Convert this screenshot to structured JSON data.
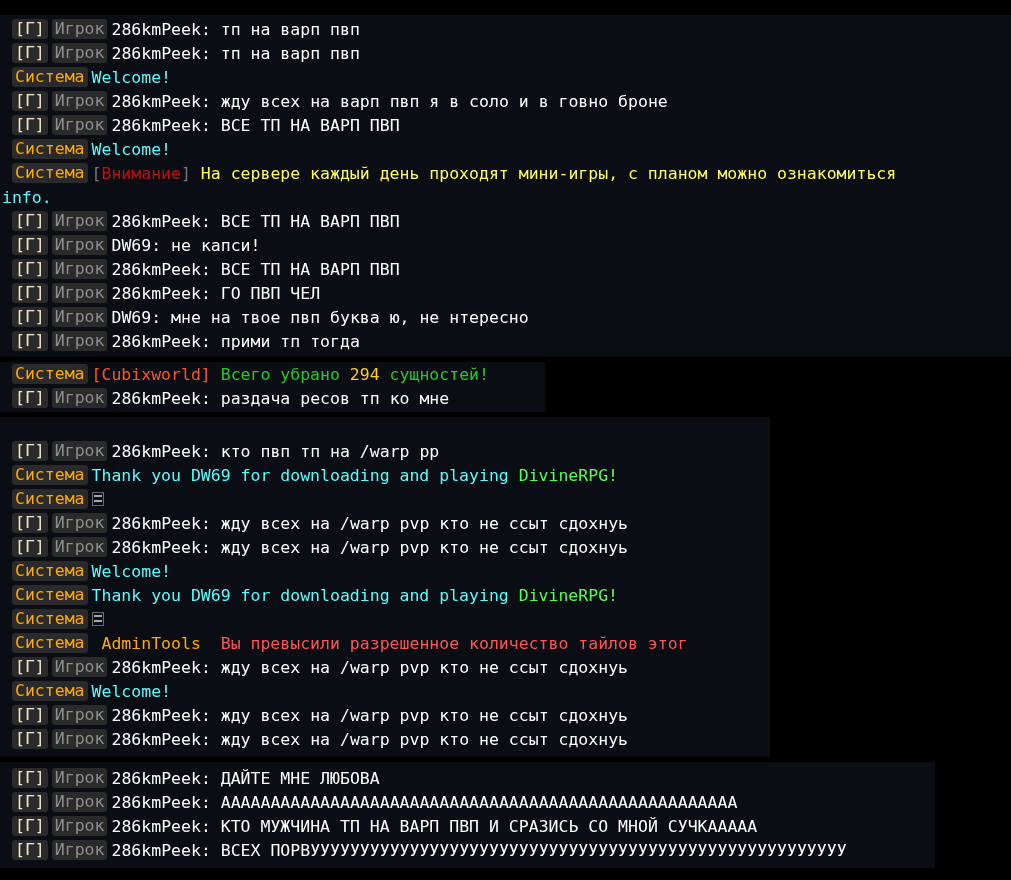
{
  "panels": [
    {
      "rows": [
        {
          "kind": "player",
          "channel": "[Г]",
          "rank": "Игрок",
          "text": "286kmPeek: тп на варп пвп"
        },
        {
          "kind": "player",
          "channel": "[Г]",
          "rank": "Игрок",
          "text": "286kmPeek: тп на варп пвп"
        },
        {
          "kind": "system",
          "rank": "Система",
          "parts": [
            {
              "text": "Welcome!",
              "color": "#55ffff"
            }
          ]
        },
        {
          "kind": "player",
          "channel": "[Г]",
          "rank": "Игрок",
          "text": "286kmPeek: жду всех на варп пвп я в соло и в говно броне"
        },
        {
          "kind": "player",
          "channel": "[Г]",
          "rank": "Игрок",
          "text": "286kmPeek: ВСЕ ТП НА ВАРП ПВП"
        },
        {
          "kind": "system",
          "rank": "Система",
          "parts": [
            {
              "text": "Welcome!",
              "color": "#55ffff"
            }
          ]
        },
        {
          "kind": "system",
          "rank": "Система",
          "parts": [
            {
              "text": "[",
              "color": "#777777"
            },
            {
              "text": "Внимание",
              "color": "#c01010"
            },
            {
              "text": "]",
              "color": "#777777"
            },
            {
              "text": " На сервере каждый день проходят мини-игры, с планом можно ознакомиться",
              "color": "#ffff55"
            }
          ]
        },
        {
          "kind": "wrap",
          "parts": [
            {
              "text": "info.",
              "color": "#55ffff"
            }
          ]
        },
        {
          "kind": "player",
          "channel": "[Г]",
          "rank": "Игрок",
          "text": "286kmPeek: ВСЕ ТП НА ВАРП ПВП"
        },
        {
          "kind": "player",
          "channel": "[Г]",
          "rank": "Игрок",
          "text": "DW69: не капси!"
        },
        {
          "kind": "player",
          "channel": "[Г]",
          "rank": "Игрок",
          "text": "286kmPeek: ВСЕ ТП НА ВАРП ПВП"
        },
        {
          "kind": "player",
          "channel": "[Г]",
          "rank": "Игрок",
          "text": "286kmPeek: ГО ПВП ЧЕЛ"
        },
        {
          "kind": "player",
          "channel": "[Г]",
          "rank": "Игрок",
          "text": "DW69: мне на твое пвп буква ю, не нтересно"
        },
        {
          "kind": "player",
          "channel": "[Г]",
          "rank": "Игрок",
          "text": "286kmPeek: прими тп тогда"
        }
      ]
    },
    {
      "rows": [
        {
          "kind": "system",
          "rank": "Система",
          "parts": [
            {
              "text": "[Cubixworld]",
              "color": "#ff5522"
            },
            {
              "text": " Всего убрано ",
              "color": "#22cc22"
            },
            {
              "text": "294",
              "color": "#ffcc22"
            },
            {
              "text": " сущностей!",
              "color": "#22cc22"
            }
          ]
        },
        {
          "kind": "player",
          "channel": "[Г]",
          "rank": "Игрок",
          "text": "286kmPeek: раздача ресов тп ко мне"
        }
      ]
    },
    {
      "rows": [
        {
          "kind": "player",
          "channel": "[Г]",
          "rank": "Игрок",
          "text": "286kmPeek: кто пвп тп на /warp pp"
        },
        {
          "kind": "system",
          "rank": "Система",
          "parts": [
            {
              "text": "Thank you DW69 for downloading and playing ",
              "color": "#55ffff"
            },
            {
              "text": "DivineRPG!",
              "color": "#55ff55"
            }
          ]
        },
        {
          "kind": "glyph",
          "rank": "Система"
        },
        {
          "kind": "player",
          "channel": "[Г]",
          "rank": "Игрок",
          "text": "286kmPeek: жду всех на /warp pvp кто не ссыт сдохнуь"
        },
        {
          "kind": "player",
          "channel": "[Г]",
          "rank": "Игрок",
          "text": "286kmPeek: жду всех на /warp pvp кто не ссыт сдохнуь"
        },
        {
          "kind": "system",
          "rank": "Система",
          "parts": [
            {
              "text": "Welcome!",
              "color": "#55ffff"
            }
          ]
        },
        {
          "kind": "system",
          "rank": "Система",
          "parts": [
            {
              "text": "Thank you DW69 for downloading and playing ",
              "color": "#55ffff"
            },
            {
              "text": "DivineRPG!",
              "color": "#55ff55"
            }
          ]
        },
        {
          "kind": "glyph",
          "rank": "Система"
        },
        {
          "kind": "system",
          "rank": "Система",
          "parts": [
            {
              "text": " AdminTools ",
              "color": "#ffaa00"
            },
            {
              "text": " Вы превысили разрешенное количество тайлов этог",
              "color": "#ff5555"
            }
          ]
        },
        {
          "kind": "player",
          "channel": "[Г]",
          "rank": "Игрок",
          "text": "286kmPeek: жду всех на /warp pvp кто не ссыт сдохнуь"
        },
        {
          "kind": "system",
          "rank": "Система",
          "parts": [
            {
              "text": "Welcome!",
              "color": "#55ffff"
            }
          ]
        },
        {
          "kind": "player",
          "channel": "[Г]",
          "rank": "Игрок",
          "text": "286kmPeek: жду всех на /warp pvp кто не ссыт сдохнуь"
        },
        {
          "kind": "player",
          "channel": "[Г]",
          "rank": "Игрок",
          "text": "286kmPeek: жду всех на /warp pvp кто не ссыт сдохнуь"
        }
      ]
    },
    {
      "rows": [
        {
          "kind": "player",
          "channel": "[Г]",
          "rank": "Игрок",
          "text": "286kmPeek: ДАЙТЕ МНЕ ЛЮБОВА"
        },
        {
          "kind": "player",
          "channel": "[Г]",
          "rank": "Игрок",
          "text": "286kmPeek: АААААААААААААААААААААААААААААААААААААААААААААААААААА"
        },
        {
          "kind": "player",
          "channel": "[Г]",
          "rank": "Игрок",
          "text": "286kmPeek: КТО МУЖЧИНА ТП НА ВАРП ПВП И СРАЗИСЬ СО МНОЙ СУЧКААААА"
        },
        {
          "kind": "player",
          "channel": "[Г]",
          "rank": "Игрок",
          "text": "286kmPeek: ВСЕХ ПОРВУУУУУУУУУУУУУУУУУУУУУУУУУУУУУУУУУУУУУУУУУУУУУУУУУУУУУУ"
        }
      ]
    }
  ]
}
